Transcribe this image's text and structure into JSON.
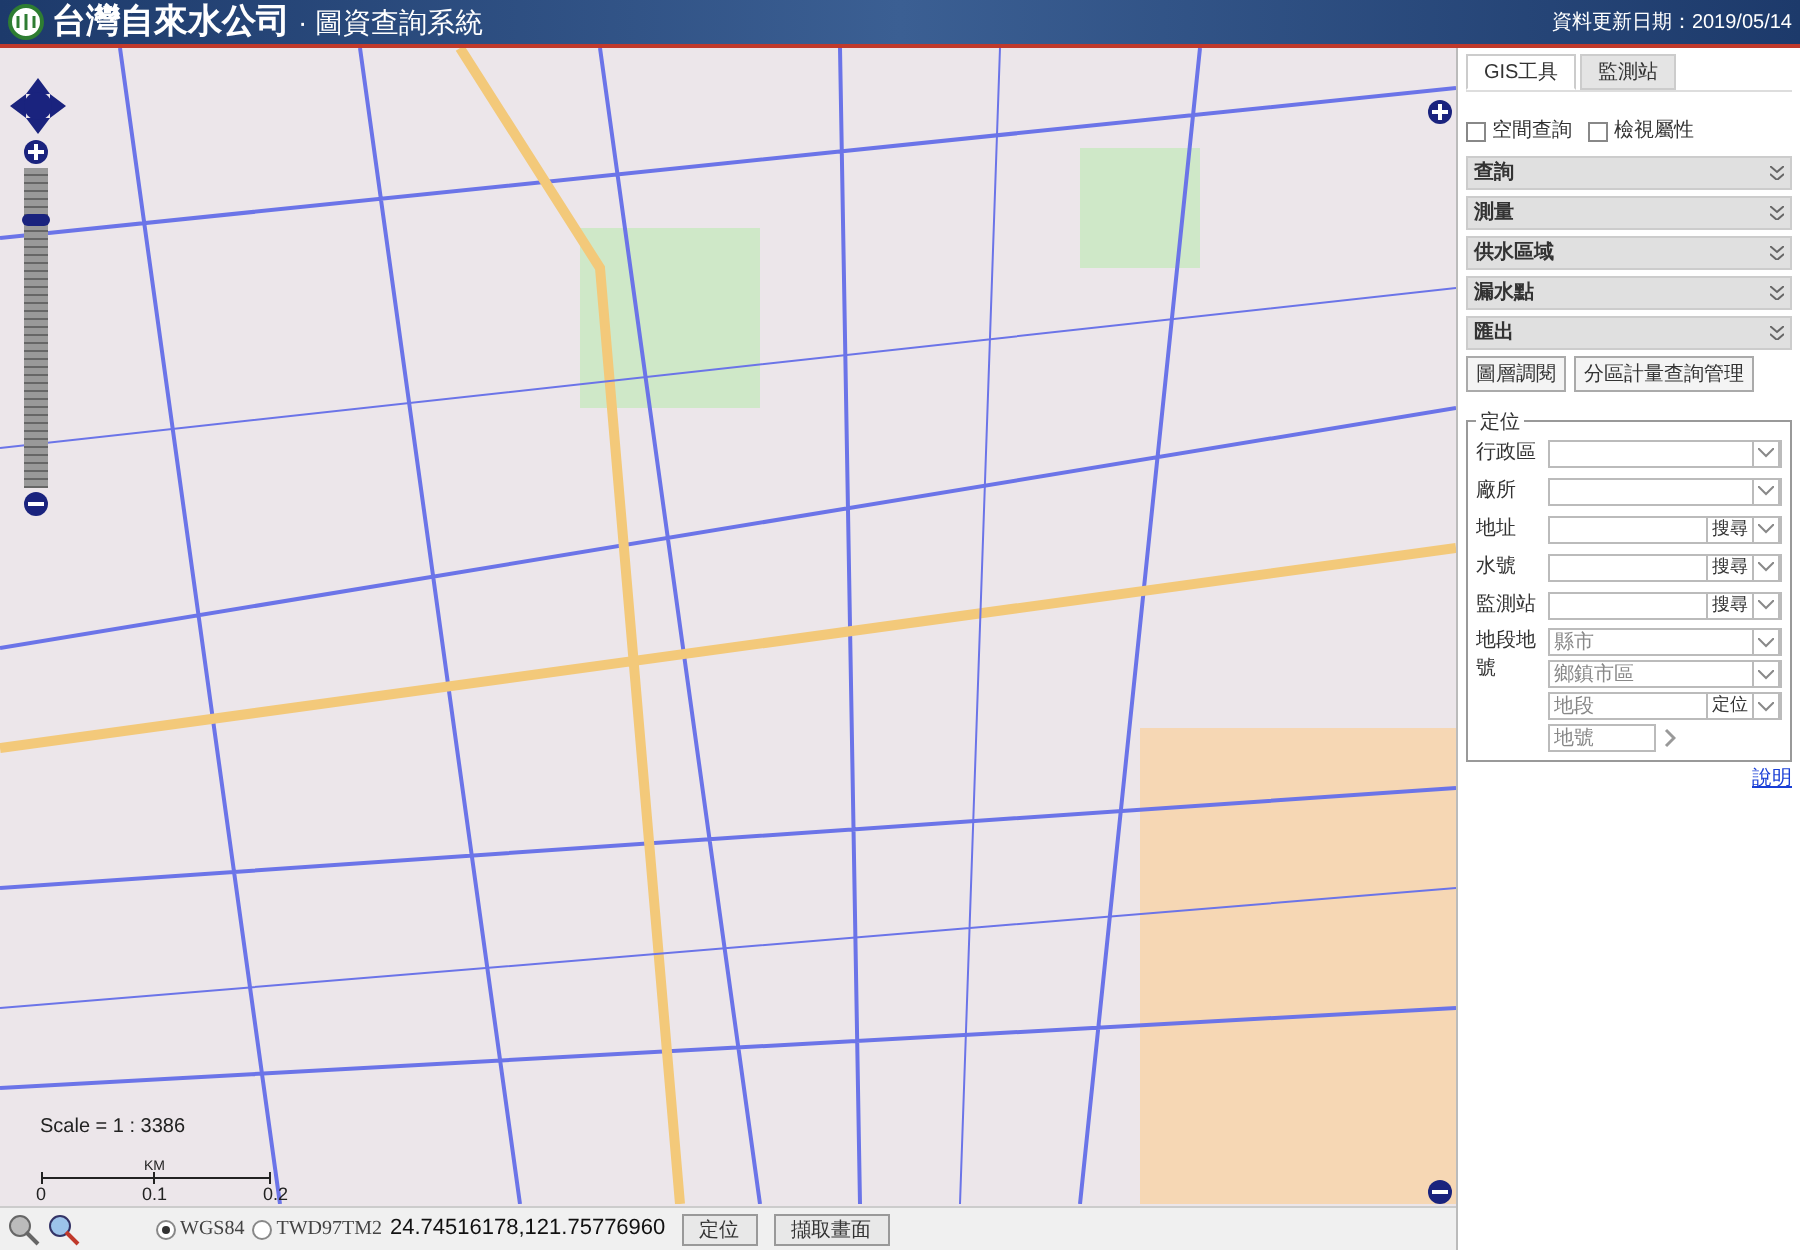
{
  "header": {
    "title": "台灣自來水公司",
    "subtitle": "· 圖資查詢系統",
    "update": "資料更新日期：2019/05/14"
  },
  "map": {
    "zoom": {
      "level": 0.85
    },
    "scale": {
      "label": "Scale = 1 : 3386",
      "unit": "KM",
      "ticks": [
        "0",
        "0.1",
        "0.2"
      ]
    }
  },
  "panel": {
    "tabs": [
      {
        "label": "GIS工具",
        "selected": true
      },
      {
        "label": "監測站",
        "selected": false
      }
    ],
    "checkboxes": [
      {
        "label": "空間查詢",
        "checked": false
      },
      {
        "label": "檢視屬性",
        "checked": false
      }
    ],
    "sections": [
      {
        "label": "查詢",
        "expanded": false
      },
      {
        "label": "測量",
        "expanded": false
      },
      {
        "label": "供水區域",
        "expanded": false
      },
      {
        "label": "漏水點",
        "expanded": false
      },
      {
        "label": "匯出",
        "expanded": false
      }
    ],
    "buttons": [
      "圖層調閱",
      "分區計量查詢管理"
    ],
    "locate": {
      "legend": "定位",
      "rows": [
        {
          "label": "行政區",
          "kind": "select"
        },
        {
          "label": "廠所",
          "kind": "select"
        },
        {
          "label": "地址",
          "kind": "search",
          "button": "搜尋"
        },
        {
          "label": "水號",
          "kind": "search",
          "button": "搜尋"
        },
        {
          "label": "監測站",
          "kind": "search",
          "button": "搜尋"
        }
      ],
      "parcel": {
        "label": "地段地號",
        "county": "縣市",
        "town": "鄉鎮市區",
        "section": "地段",
        "section_button": "定位",
        "number": {
          "placeholder": "地號"
        }
      }
    },
    "help": "說明"
  },
  "bottom": {
    "coords": [
      {
        "label": "WGS84",
        "selected": true
      },
      {
        "label": "TWD97TM2",
        "selected": false
      }
    ],
    "value": "24.74516178,121.75776960",
    "buttons": [
      "定位",
      "擷取畫面"
    ]
  }
}
